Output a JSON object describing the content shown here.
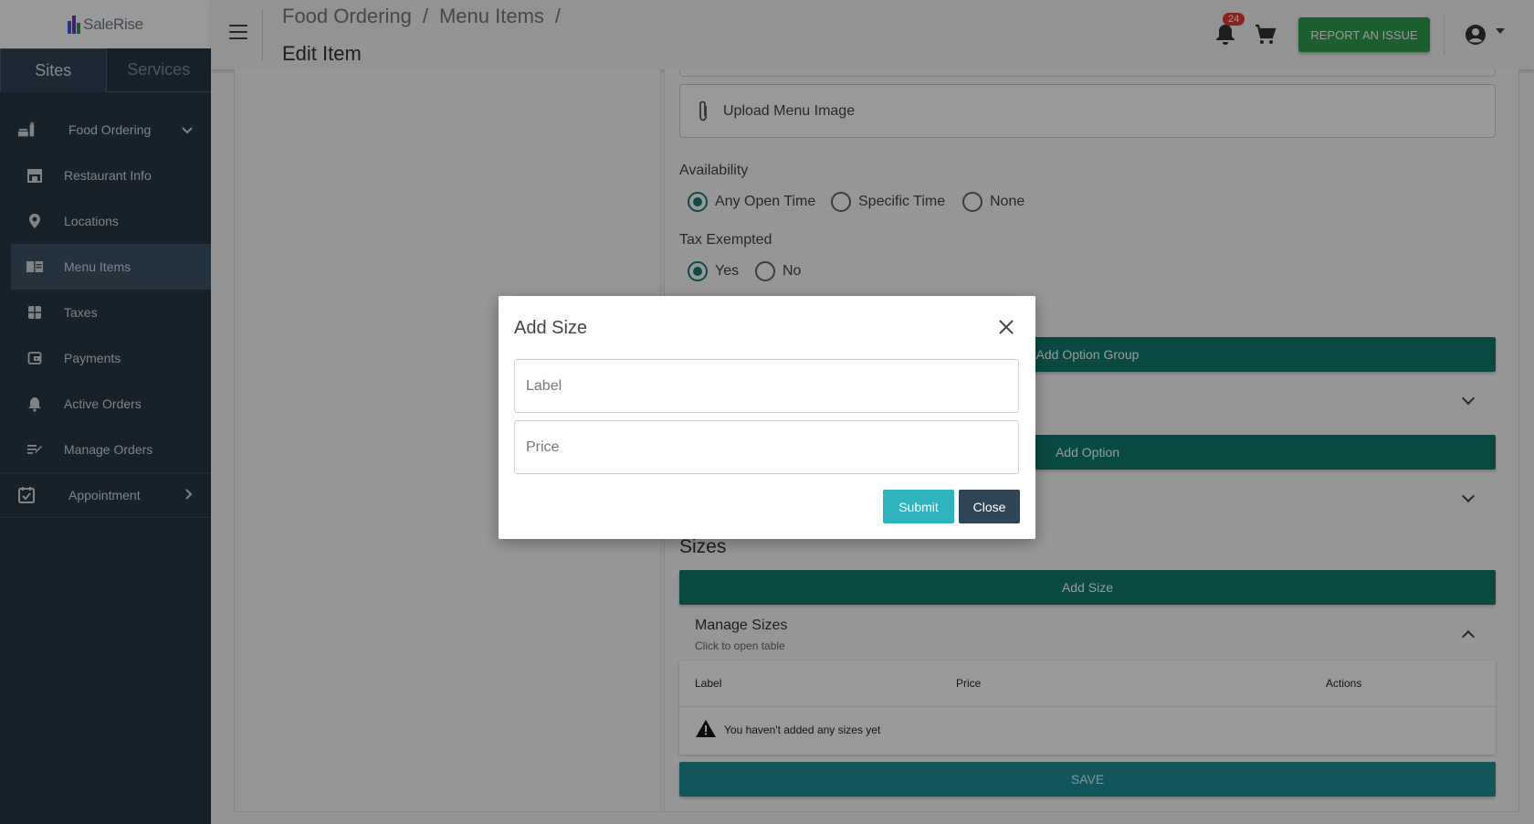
{
  "brand": {
    "name": "SaleRise"
  },
  "sidebar": {
    "tabs": [
      {
        "label": "Sites"
      },
      {
        "label": "Services"
      }
    ],
    "items": [
      {
        "label": "Food Ordering",
        "icon": "food-ordering-icon"
      },
      {
        "label": "Restaurant Info",
        "icon": "storefront-icon"
      },
      {
        "label": "Locations",
        "icon": "location-pin-icon"
      },
      {
        "label": "Menu Items",
        "icon": "menu-book-icon"
      },
      {
        "label": "Taxes",
        "icon": "calculator-icon"
      },
      {
        "label": "Payments",
        "icon": "wallet-icon"
      },
      {
        "label": "Active Orders",
        "icon": "bell-ring-icon"
      },
      {
        "label": "Manage Orders",
        "icon": "edit-list-icon"
      },
      {
        "label": "Appointment",
        "icon": "calendar-check-icon"
      }
    ]
  },
  "header": {
    "breadcrumb": [
      "Food Ordering",
      "/",
      "Menu Items",
      "/"
    ],
    "title": "Edit Item",
    "notification_count": "24",
    "report_button": "REPORT AN ISSUE"
  },
  "form": {
    "upload_label": "Upload Menu Image",
    "availability": {
      "label": "Availability",
      "options": [
        "Any Open Time",
        "Specific Time",
        "None"
      ],
      "selected": "Any Open Time"
    },
    "tax_exempted": {
      "label": "Tax Exempted",
      "options": [
        "Yes",
        "No"
      ],
      "selected": "Yes"
    },
    "add_option_group_button": "Add Option Group",
    "add_option_button": "Add Option",
    "sizes_title": "Sizes",
    "add_size_button": "Add Size",
    "manage_sizes": {
      "title": "Manage Sizes",
      "subtitle": "Click to open table",
      "columns": [
        "Label",
        "Price",
        "Actions"
      ],
      "empty_message": "You haven't added any sizes yet"
    },
    "save_button": "SAVE"
  },
  "modal": {
    "title": "Add Size",
    "label_placeholder": "Label",
    "price_placeholder": "Price",
    "submit_button": "Submit",
    "close_button": "Close"
  },
  "colors": {
    "sidebar_bg": "#263746",
    "teal_primary": "#117a6e",
    "report_green": "#2e9e4f",
    "submit_teal": "#2fb3bd",
    "close_dark": "#2f4456",
    "badge_red": "#e53935"
  }
}
